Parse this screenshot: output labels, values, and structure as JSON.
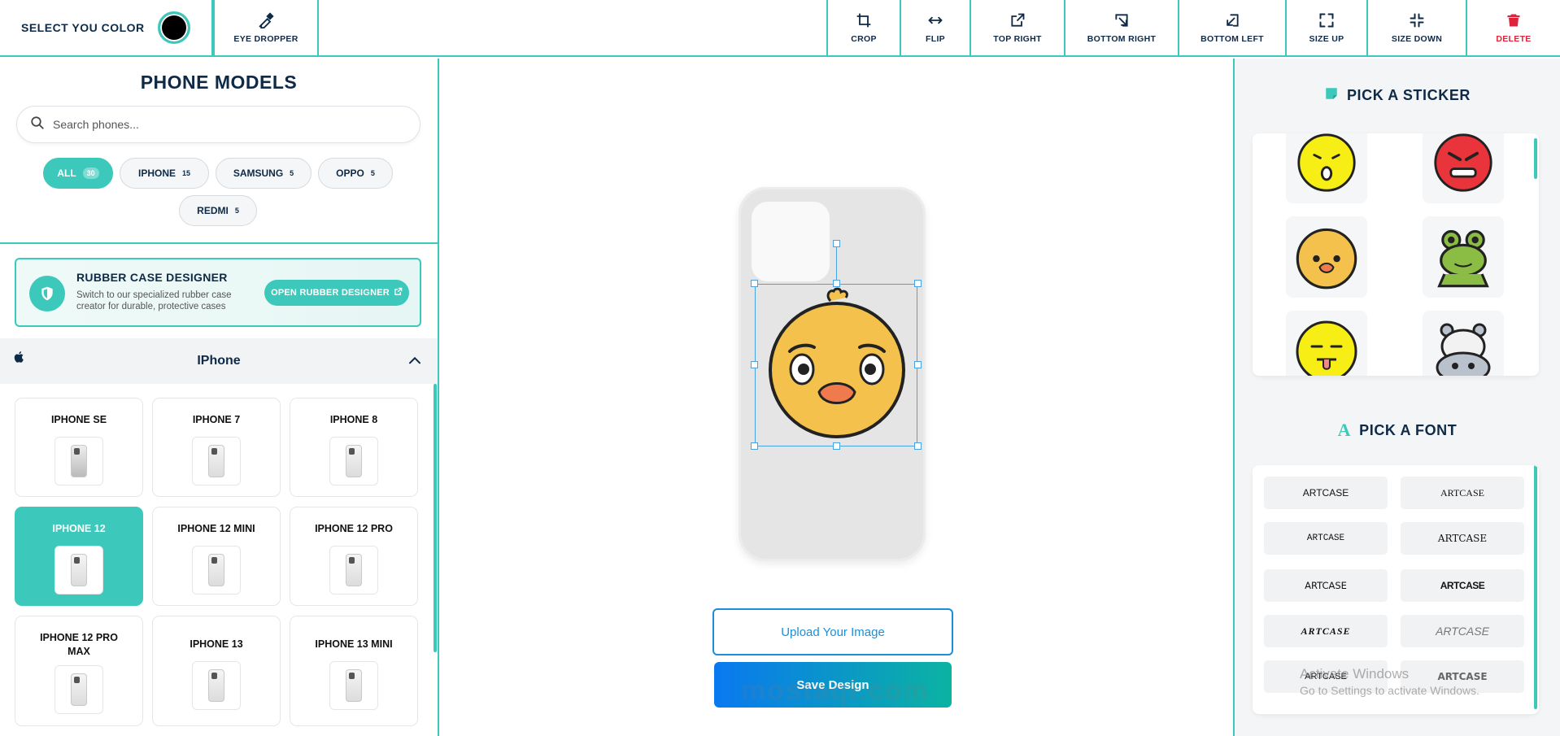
{
  "toolbar": {
    "color_label": "SELECT YOU COLOR",
    "selected_color": "#000000",
    "eye_dropper": "EYE DROPPER",
    "crop": "CROP",
    "flip": "FLIP",
    "top_right": "TOP RIGHT",
    "bottom_right": "BOTTOM RIGHT",
    "bottom_left": "BOTTOM LEFT",
    "size_up": "SIZE UP",
    "size_down": "SIZE DOWN",
    "delete": "DELETE"
  },
  "phone_models": {
    "title": "PHONE MODELS",
    "search_placeholder": "Search phones...",
    "filters": [
      {
        "label": "ALL",
        "count": "30",
        "active": true
      },
      {
        "label": "IPHONE",
        "count": "15"
      },
      {
        "label": "SAMSUNG",
        "count": "5"
      },
      {
        "label": "OPPO",
        "count": "5"
      },
      {
        "label": "REDMI",
        "count": "5"
      }
    ],
    "rubber": {
      "title": "RUBBER CASE DESIGNER",
      "desc": "Switch to our specialized rubber case creator for durable, protective cases",
      "button": "OPEN RUBBER DESIGNER"
    },
    "group_title": "IPhone",
    "models": [
      "IPHONE SE",
      "IPHONE 7",
      "IPHONE 8",
      "IPHONE 12",
      "IPHONE 12 MINI",
      "IPHONE 12 PRO",
      "IPHONE 12 PRO MAX",
      "IPHONE 13",
      "IPHONE 13 MINI"
    ],
    "selected_model": "IPHONE 12"
  },
  "canvas": {
    "upload_label": "Upload Your Image",
    "save_label": "Save Design",
    "watermark": "mostaql.com"
  },
  "stickers": {
    "title": "PICK A STICKER",
    "items": [
      "shocked-emoji",
      "angry-emoji",
      "chick-face",
      "frog",
      "tongue-emoji",
      "hippo"
    ]
  },
  "fonts": {
    "title": "PICK A FONT",
    "sample": "ARTCASE"
  },
  "os_notice": {
    "line1": "Activate Windows",
    "line2": "Go to Settings to activate Windows."
  },
  "colors": {
    "accent": "#3cc9bb",
    "navy": "#0e2a47",
    "danger": "#e0223a",
    "upload_blue": "#1b8fd8"
  }
}
